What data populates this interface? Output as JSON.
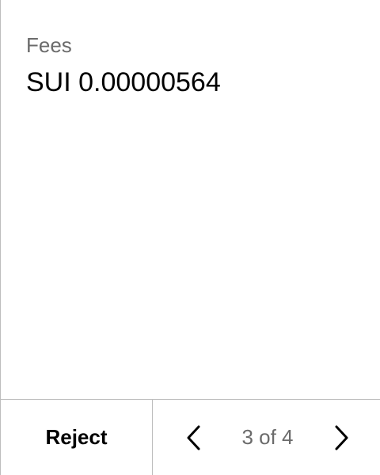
{
  "content": {
    "label": "Fees",
    "value": "SUI 0.00000564"
  },
  "footer": {
    "reject_label": "Reject",
    "prev_icon": "chevron-left-icon",
    "next_icon": "chevron-right-icon",
    "page_indicator": "3 of 4"
  },
  "colors": {
    "label": "#6b6b6b",
    "value": "#000000",
    "divider": "#bdbdbd",
    "background": "#ffffff"
  }
}
